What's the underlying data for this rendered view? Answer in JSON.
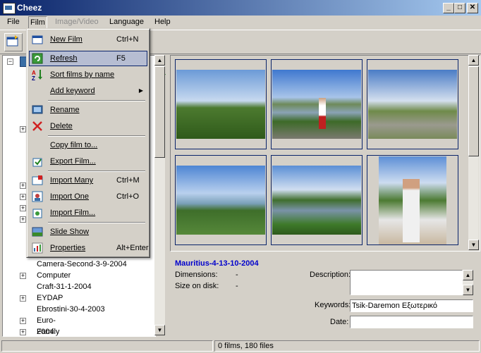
{
  "window": {
    "title": "Cheez"
  },
  "menubar": [
    "File",
    "Film",
    "Image/Video",
    "Language",
    "Help"
  ],
  "film_menu": {
    "items": [
      {
        "label": "New Film",
        "shortcut": "Ctrl+N",
        "icon": "new-film-icon"
      },
      {
        "label": "Refresh",
        "shortcut": "F5",
        "icon": "refresh-icon"
      },
      {
        "label": "Sort films by name",
        "shortcut": "",
        "icon": "sort-az-icon"
      },
      {
        "label": "Add keyword",
        "shortcut": "",
        "icon": ""
      },
      {
        "label": "Rename",
        "shortcut": "",
        "icon": "rename-icon"
      },
      {
        "label": "Delete",
        "shortcut": "",
        "icon": "delete-icon"
      },
      {
        "label": "Copy film to...",
        "shortcut": "",
        "icon": ""
      },
      {
        "label": "Export Film...",
        "shortcut": "",
        "icon": "export-icon"
      },
      {
        "label": "Import Many",
        "shortcut": "Ctrl+M",
        "icon": "import-many-icon"
      },
      {
        "label": "Import One",
        "shortcut": "Ctrl+O",
        "icon": "import-one-icon"
      },
      {
        "label": "Import Film...",
        "shortcut": "",
        "icon": "import-film-icon"
      },
      {
        "label": "Slide Show",
        "shortcut": "",
        "icon": "slideshow-icon"
      },
      {
        "label": "Properties",
        "shortcut": "Alt+Enter",
        "icon": "properties-icon"
      }
    ]
  },
  "tree": {
    "items": [
      "Camera-Second-3-9-2004",
      "Computer",
      "Craft-31-1-2004",
      "EYDAP",
      "Ebrostini-30-4-2003",
      "Euro-2004",
      "Family"
    ]
  },
  "info": {
    "film_name": "Mauritius-4-13-10-2004",
    "dimensions_label": "Dimensions:",
    "dimensions_value": "-",
    "size_label": "Size on disk:",
    "size_value": "-",
    "description_label": "Description:",
    "description_value": "",
    "keywords_label": "Keywords:",
    "keywords_value": "Tsik-Daremon Εξωτερικό",
    "date_label": "Date:",
    "date_value": ""
  },
  "status": {
    "text": "0 films, 180 files"
  },
  "colors": {
    "title_start": "#0a246a",
    "title_end": "#a6caf0",
    "film_name": "#0000cc",
    "face": "#d4d0c8"
  }
}
